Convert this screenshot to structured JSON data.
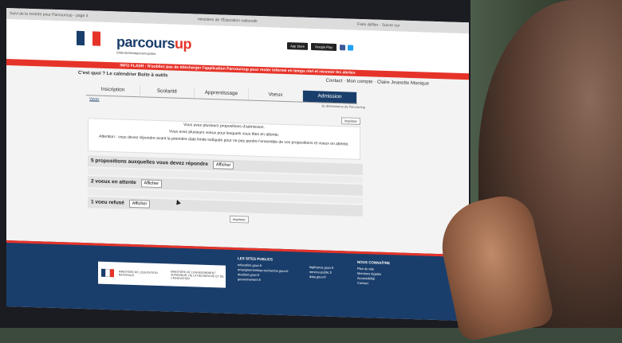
{
  "browser": {
    "tab_title": "Suivi de la rentrée pour Parcoursup - page 4",
    "url_hint": "ministère de l'Éducation nationale",
    "right_text": "Faire défiler · Suivre sur"
  },
  "header": {
    "logo_main": "parcours",
    "logo_accent": "up",
    "logo_tagline": "Entrée dans l'enseignement supérieur",
    "app_store": "App Store",
    "google_play": "Google Play"
  },
  "flash": {
    "text": "INFO FLASH : N'oubliez pas de télécharger l'application Parcoursup pour rester informé en temps réel et recevoir les alertes"
  },
  "topnav": {
    "left": "C'est quoi ?   Le calendrier   Boite à outils",
    "right": "Contact   ·   Mon compte   ·   Claire Jeanette Monique"
  },
  "tabs": [
    "Inscription",
    "Scolarité",
    "Apprentissage",
    "Voeux",
    "Admission"
  ],
  "subtab": "Voeux",
  "subright": "Je démissionne de Parcoursup",
  "print_label": "Imprimer",
  "message": [
    "Vous avez plusieurs propositions d'admission.",
    "Vous avez plusieurs voeux pour lesquels vous êtes en attente.",
    "Attention : vous devez répondre avant la première date limite indiquée pour ne pas perdre l'ensemble de vos propositions et voeux en attente."
  ],
  "sections": {
    "propositions": "5 propositions auxquelles vous devez répondre",
    "attente": "2 voeux en attente",
    "refuse": "1 voeu refusé",
    "show_label": "Afficher"
  },
  "footer": {
    "ministry1": "MINISTÈRE DE L'ÉDUCATION NATIONALE",
    "ministry2": "MINISTÈRE DE L'ENSEIGNEMENT SUPÉRIEUR, DE LA RECHERCHE ET DE L'INNOVATION",
    "col1_title": "LES SITES PUBLICS",
    "col1": [
      "education.gouv.fr",
      "enseignementsup-recherche.gouv.fr",
      "etudiant.gouv.fr",
      "gouvernement.fr"
    ],
    "col2": [
      "legifrance.gouv.fr",
      "service-public.fr",
      "data.gouv.fr"
    ],
    "col3_title": "NOUS CONNAÎTRE",
    "col3": [
      "Plan du site",
      "Mentions légales",
      "Accessibilité",
      "Contact"
    ]
  },
  "colors": {
    "navy": "#1a3e6b",
    "red": "#e63329"
  }
}
